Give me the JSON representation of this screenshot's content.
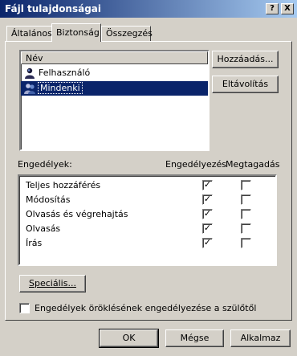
{
  "window": {
    "title": "Fájl tulajdonságai",
    "help_btn": "?",
    "close_btn": "X"
  },
  "tabs": [
    {
      "label": "Általános",
      "active": false
    },
    {
      "label": "Biztonság",
      "active": true
    },
    {
      "label": "Összegzés",
      "active": false
    }
  ],
  "users": {
    "header": "Név",
    "items": [
      {
        "label": "Felhasználó",
        "selected": false
      },
      {
        "label": "Mindenki",
        "selected": true
      }
    ],
    "add_btn": "Hozzáadás...",
    "remove_btn": "Eltávolítás"
  },
  "permissions": {
    "label": "Engedélyek:",
    "allow_header": "Engedélyezés",
    "deny_header": "Megtagadás",
    "rows": [
      {
        "name": "Teljes hozzáférés",
        "allow": "✓",
        "deny": ""
      },
      {
        "name": "Módosítás",
        "allow": "✓",
        "deny": ""
      },
      {
        "name": "Olvasás és végrehajtás",
        "allow": "✓",
        "deny": ""
      },
      {
        "name": "Olvasás",
        "allow": "✓",
        "deny": ""
      },
      {
        "name": "Írás",
        "allow": "✓",
        "deny": ""
      }
    ]
  },
  "advanced_btn": "Speciális...",
  "inherit": {
    "label": "Engedélyek öröklésének engedélyezése a szülőtől",
    "checked": ""
  },
  "footer": {
    "ok": "OK",
    "cancel": "Mégse",
    "apply": "Alkalmaz"
  }
}
